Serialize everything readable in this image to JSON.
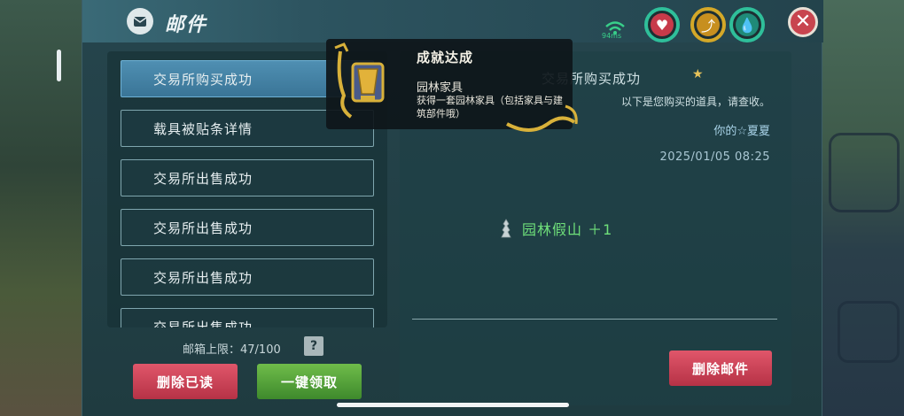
{
  "window": {
    "title": "邮件"
  },
  "status": {
    "ping": "94ms"
  },
  "mail_list": {
    "items": [
      {
        "label": "交易所购买成功",
        "selected": true
      },
      {
        "label": "载具被贴条详情",
        "selected": false
      },
      {
        "label": "交易所出售成功",
        "selected": false
      },
      {
        "label": "交易所出售成功",
        "selected": false
      },
      {
        "label": "交易所出售成功",
        "selected": false
      },
      {
        "label": "交易所出售成功",
        "selected": false
      }
    ],
    "limit_text": "邮箱上限：47/100",
    "help_label": "?"
  },
  "buttons": {
    "delete_read": "删除已读",
    "claim_all": "一键领取",
    "delete_mail": "删除邮件"
  },
  "mail_detail": {
    "title": "交易所购买成功",
    "body": "以下是您购买的道具，请查收。",
    "sender": "你的☆夏夏",
    "date": "2025/01/05 08:25",
    "attachment": "园林假山 ＋1"
  },
  "achievement_toast": {
    "title": "成就达成",
    "subtitle": "园林家具",
    "description": "获得一套园林家具（包括家具与建筑部件哦）"
  },
  "colors": {
    "selected_item": "#4f8fb2",
    "delete_red": "#c73a4a",
    "claim_green": "#3e8a2c",
    "attachment_green": "#6fe07a"
  }
}
